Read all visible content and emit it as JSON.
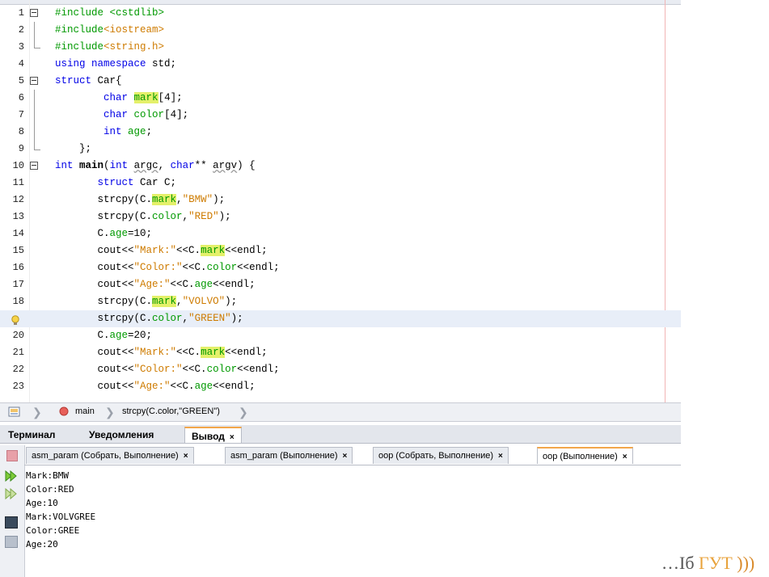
{
  "editor": {
    "lines": [
      {
        "num": "1",
        "html": "<span class='pp'>#include &lt;cstdlib&gt;</span>"
      },
      {
        "num": "2",
        "html": "<span class='pp'>#include</span><span class='str'>&lt;iostream&gt;</span>"
      },
      {
        "num": "3",
        "html": "<span class='pp'>#include</span><span class='str'>&lt;string.h&gt;</span>"
      },
      {
        "num": "4",
        "html": "<span class='kw'>using namespace</span> std;"
      },
      {
        "num": "5",
        "html": "<span class='kw'>struct</span> Car{"
      },
      {
        "num": "6",
        "html": "        <span class='kw'>char</span> <span class='hl'>mark</span>[4];"
      },
      {
        "num": "7",
        "html": "        <span class='kw'>char</span> <span class='fld'>color</span>[4];"
      },
      {
        "num": "8",
        "html": "        <span class='kw'>int</span> <span class='fld'>age</span>;"
      },
      {
        "num": "9",
        "html": "    };"
      },
      {
        "num": "10",
        "html": "<span class='kw'>int</span> <span class='b'>main</span>(<span class='kw'>int</span> <span class='u'>argc</span>, <span class='kw'>char</span>** <span class='u'>argv</span>) {"
      },
      {
        "num": "11",
        "html": "       <span class='kw'>struct</span> Car C;"
      },
      {
        "num": "12",
        "html": "       strcpy(C.<span class='hl'>mark</span>,<span class='str'>\"BMW\"</span>);"
      },
      {
        "num": "13",
        "html": "       strcpy(C.<span class='fld'>color</span>,<span class='str'>\"RED\"</span>);"
      },
      {
        "num": "14",
        "html": "       C.<span class='fld'>age</span>=10;"
      },
      {
        "num": "15",
        "html": "       cout&lt;&lt;<span class='str'>\"Mark:\"</span>&lt;&lt;C.<span class='hl'>mark</span>&lt;&lt;endl;"
      },
      {
        "num": "16",
        "html": "       cout&lt;&lt;<span class='str'>\"Color:\"</span>&lt;&lt;C.<span class='fld'>color</span>&lt;&lt;endl;"
      },
      {
        "num": "17",
        "html": "       cout&lt;&lt;<span class='str'>\"Age:\"</span>&lt;&lt;C.<span class='fld'>age</span>&lt;&lt;endl;"
      },
      {
        "num": "18",
        "html": "       strcpy(C.<span class='hl'>mark</span>,<span class='str'>\"VOLVO\"</span>);"
      },
      {
        "num": "",
        "html": "       strcpy(C.<span class='fld'>color</span>,<span class='str'>\"GREEN\"</span>);"
      },
      {
        "num": "20",
        "html": "       C.<span class='fld'>age</span>=20;"
      },
      {
        "num": "21",
        "html": "       cout&lt;&lt;<span class='str'>\"Mark:\"</span>&lt;&lt;C.<span class='hl'>mark</span>&lt;&lt;endl;"
      },
      {
        "num": "22",
        "html": "       cout&lt;&lt;<span class='str'>\"Color:\"</span>&lt;&lt;C.<span class='fld'>color</span>&lt;&lt;endl;"
      },
      {
        "num": "23",
        "html": "       cout&lt;&lt;<span class='str'>\"Age:\"</span>&lt;&lt;C.<span class='fld'>age</span>&lt;&lt;endl;"
      }
    ]
  },
  "breadcrumb": {
    "function": "main",
    "statement": "strcpy(C.color,\"GREEN\")"
  },
  "panel_tabs": [
    {
      "label": "Терминал"
    },
    {
      "label": "Уведомления"
    },
    {
      "label": "Вывод"
    }
  ],
  "close_glyph": "×",
  "output_tabs": [
    {
      "label": "asm_param (Собрать, Выполнение)"
    },
    {
      "label": "asm_param (Выполнение)"
    },
    {
      "label": "oop (Собрать, Выполнение)"
    },
    {
      "label": "oop (Выполнение)"
    }
  ],
  "output_lines": [
    "Mark:BMW",
    "Color:RED",
    "Age:10",
    "Mark:VOLVGREE",
    "Color:GREE",
    "Age:20"
  ],
  "logo": {
    "prefix": "…Іб",
    "brand": "ГУТ",
    "suffix": ")))",
    "brand_color": "#e8a23a",
    "suffix_color": "#d98a2a"
  }
}
